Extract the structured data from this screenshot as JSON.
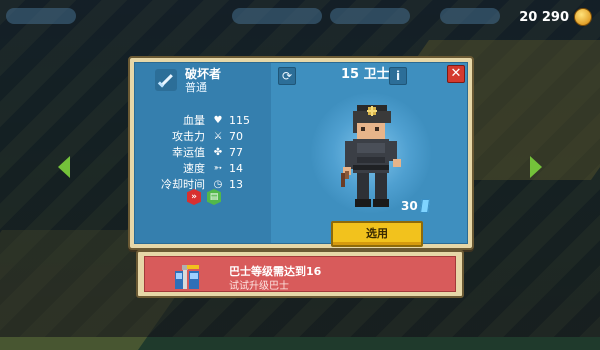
{
  "topbar": {
    "coins": "20 290",
    "coin_icon": "gold-coin-icon"
  },
  "panel": {
    "weapon": {
      "name": "破坏者",
      "rarity": "普通",
      "icon": "sword-icon"
    },
    "stats": [
      {
        "label": "血量",
        "icon": "heart-icon",
        "value": "115"
      },
      {
        "label": "攻击力",
        "icon": "sword-icon",
        "value": "70"
      },
      {
        "label": "幸运值",
        "icon": "clover-icon",
        "value": "77"
      },
      {
        "label": "速度",
        "icon": "wing-icon",
        "value": "14"
      },
      {
        "label": "冷却时间",
        "icon": "clock-icon",
        "value": "13"
      }
    ],
    "badges": [
      {
        "icon": "speed-badge-icon",
        "glyph": "»",
        "color": "#d83030"
      },
      {
        "icon": "card-badge-icon",
        "glyph": "▤",
        "color": "#52b84a"
      }
    ],
    "unit": {
      "level": "15",
      "name": "卫士"
    },
    "price": {
      "value": "30",
      "icon": "gem-icon"
    },
    "select_button": "选用",
    "close_icon": "close-icon",
    "refresh_icon": "refresh-icon",
    "info_icon": "info-icon"
  },
  "notice": {
    "title": "巴士等级需达到16",
    "subtitle": "试试升级巴士",
    "icon": "bus-upgrade-icon"
  },
  "colors": {
    "panel_blue": "#3e8fbf",
    "frame": "#e6d7a8",
    "select_yellow": "#f2c21d",
    "notice_red": "#d85b5b",
    "close_red": "#d43a2e"
  }
}
